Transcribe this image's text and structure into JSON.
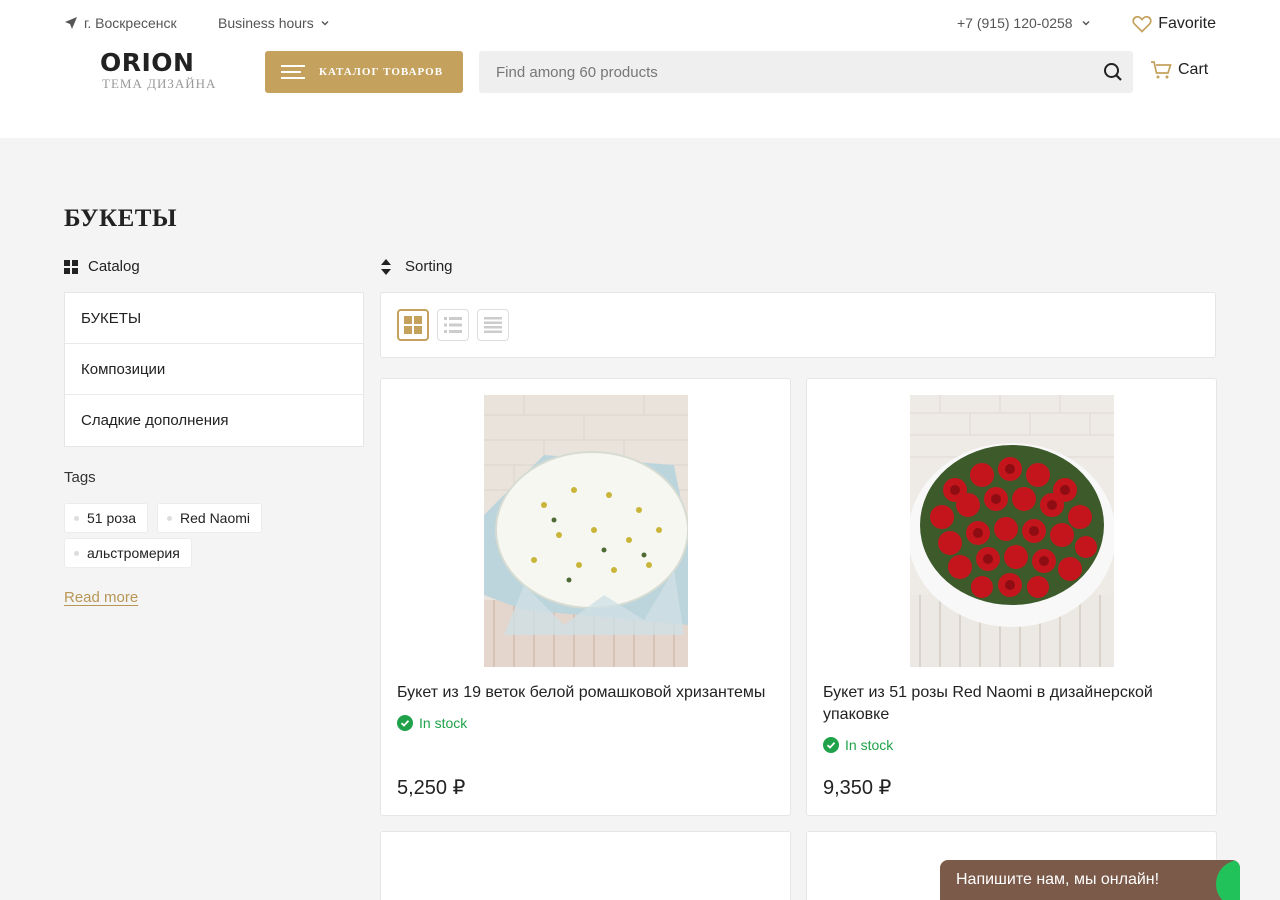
{
  "header": {
    "city": "г. Воскресенск",
    "hours_label": "Business hours",
    "phone": "+7 (915) 120-0258",
    "favorite_label": "Favorite",
    "logo_main": "ORION",
    "logo_sub": "ТЕМА ДИЗАЙНА",
    "catalog_button": "КАТАЛОГ ТОВАРОВ",
    "search_placeholder": "Find among 60 products",
    "cart_label": "Cart"
  },
  "page": {
    "title": "БУКЕТЫ"
  },
  "sidebar": {
    "catalog_label": "Catalog",
    "items": [
      {
        "label": "БУКЕТЫ"
      },
      {
        "label": "Композиции"
      },
      {
        "label": "Сладкие дополнения"
      }
    ],
    "tags_title": "Tags",
    "tags": [
      "51 роза",
      "Red Naomi",
      "альстромерия"
    ],
    "read_more": "Read more"
  },
  "toolbar": {
    "sorting_label": "Sorting",
    "views": [
      "grid",
      "list",
      "table"
    ],
    "active_view": "grid"
  },
  "products": [
    {
      "name": "Букет из 19 веток белой ромашковой хризантемы",
      "stock": "In stock",
      "price": "5,250 ₽"
    },
    {
      "name": "Букет из 51 розы Red Naomi в дизайнерской упаковке",
      "stock": "In stock",
      "price": "9,350 ₽"
    }
  ],
  "chat": {
    "label": "Напишите нам, мы онлайн!"
  },
  "colors": {
    "accent": "#c4a15d",
    "in_stock": "#20a24a",
    "chat_bg": "#7b5a4a"
  }
}
